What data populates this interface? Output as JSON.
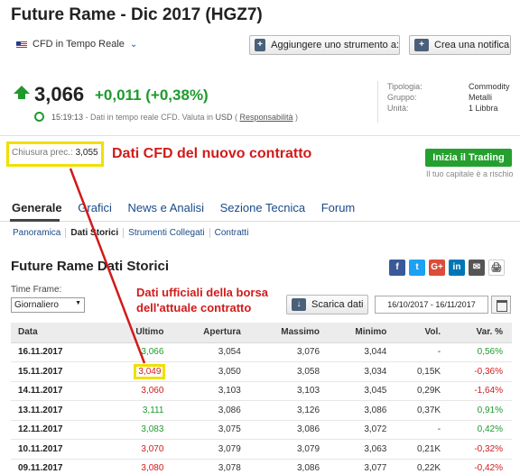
{
  "header": {
    "title": "Future Rame - Dic 2017 (HGZ7)",
    "cfd_selector": "CFD in Tempo Reale",
    "add_instrument_label": "Aggiungere uno strumento a:",
    "create_alert_label": "Crea una notifica"
  },
  "quote": {
    "price": "3,066",
    "change": "+0,011",
    "change_pct": "(+0,38%)",
    "time": "15:19:13",
    "realtime_text": "- Dati in tempo reale CFD. Valuta in",
    "currency": "USD",
    "responsibility": "Responsabilità",
    "direction": "up"
  },
  "meta": {
    "labels": [
      "Tipologia:",
      "Gruppo:",
      "Unità:"
    ],
    "values": [
      "Commodity",
      "Metalli",
      "1 Libbra"
    ]
  },
  "prev_close": {
    "label": "Chiusura prec.:",
    "value": "3,055"
  },
  "annotations": {
    "cfd_note": "Dati CFD del nuovo contratto",
    "official_note_1": "Dati ufficiali della borsa",
    "official_note_2": "dell'attuale contratto"
  },
  "trade": {
    "button": "Inizia il Trading",
    "risk": "Il tuo capitale è a rischio"
  },
  "tabs": [
    "Generale",
    "Grafici",
    "News e Analisi",
    "Sezione Tecnica",
    "Forum"
  ],
  "subtabs": [
    "Panoramica",
    "Dati Storici",
    "Strumenti Collegati",
    "Contratti"
  ],
  "historical": {
    "title": "Future Rame Dati Storici",
    "timeframe_label": "Time Frame:",
    "timeframe_value": "Giornaliero",
    "download_label": "Scarica dati",
    "date_range": "16/10/2017 - 16/11/2017",
    "columns": [
      "Data",
      "Ultimo",
      "Apertura",
      "Massimo",
      "Minimo",
      "Vol.",
      "Var. %"
    ],
    "rows": [
      [
        "16.11.2017",
        "3,066",
        "3,054",
        "3,076",
        "3,044",
        "-",
        "0,56%"
      ],
      [
        "15.11.2017",
        "3,049",
        "3,050",
        "3,058",
        "3,034",
        "0,15K",
        "-0,36%"
      ],
      [
        "14.11.2017",
        "3,060",
        "3,103",
        "3,103",
        "3,045",
        "0,29K",
        "-1,64%"
      ],
      [
        "13.11.2017",
        "3,111",
        "3,086",
        "3,126",
        "3,086",
        "0,37K",
        "0,91%"
      ],
      [
        "12.11.2017",
        "3,083",
        "3,075",
        "3,086",
        "3,072",
        "-",
        "0,42%"
      ],
      [
        "10.11.2017",
        "3,070",
        "3,079",
        "3,079",
        "3,063",
        "0,21K",
        "-0,32%"
      ],
      [
        "09.11.2017",
        "3,080",
        "3,078",
        "3,086",
        "3,077",
        "0,22K",
        "-0,42%"
      ]
    ],
    "trends": [
      "up",
      "down",
      "down",
      "up",
      "up",
      "down",
      "down"
    ]
  },
  "social": [
    "f",
    "t",
    "G+",
    "in",
    "✉",
    "🖨"
  ],
  "colors": {
    "up": "#1e9a2d",
    "down": "#d21a1a",
    "highlight": "#f0e000",
    "annotation": "#d21a1a"
  }
}
